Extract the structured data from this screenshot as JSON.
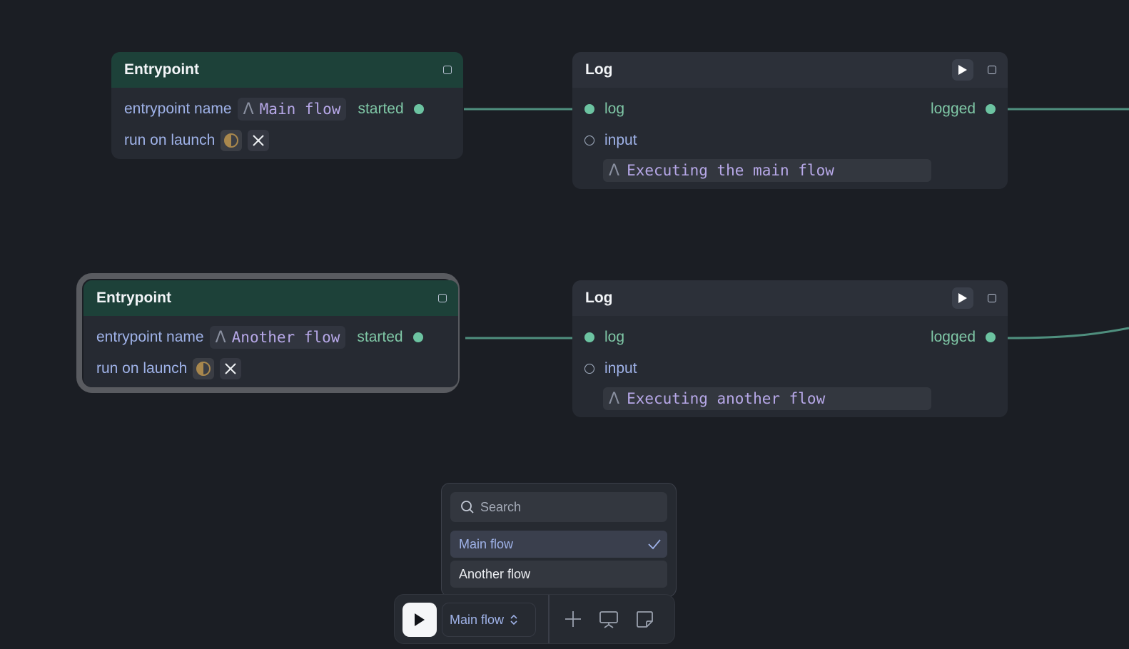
{
  "nodes": {
    "entry1": {
      "title": "Entrypoint",
      "name_label": "entrypoint name",
      "name_value": "Main flow",
      "output_label": "started",
      "run_label": "run on launch"
    },
    "entry2": {
      "title": "Entrypoint",
      "name_label": "entrypoint name",
      "name_value": "Another flow",
      "output_label": "started",
      "run_label": "run on launch"
    },
    "log1": {
      "title": "Log",
      "input_label": "log",
      "output_label": "logged",
      "value_label": "input",
      "value": "Executing the main flow"
    },
    "log2": {
      "title": "Log",
      "input_label": "log",
      "output_label": "logged",
      "value_label": "input",
      "value": "Executing another flow"
    }
  },
  "dropdown": {
    "search_placeholder": "Search",
    "options": [
      "Main flow",
      "Another flow"
    ],
    "selected": "Main flow"
  },
  "toolbar": {
    "flow_select_label": "Main flow"
  },
  "colors": {
    "background": "#1b1e24",
    "entry_header": "#1d4139",
    "port": "#6cc3a1",
    "accent_text": "#9fb2e8",
    "string_value": "#b7a8e8"
  },
  "icons": [
    "play-icon",
    "stop-icon",
    "string-type-icon",
    "half-circle-toggle-icon",
    "close-icon",
    "search-icon",
    "check-icon",
    "chevron-updown-icon",
    "plus-icon",
    "presentation-icon",
    "sticky-note-icon"
  ]
}
